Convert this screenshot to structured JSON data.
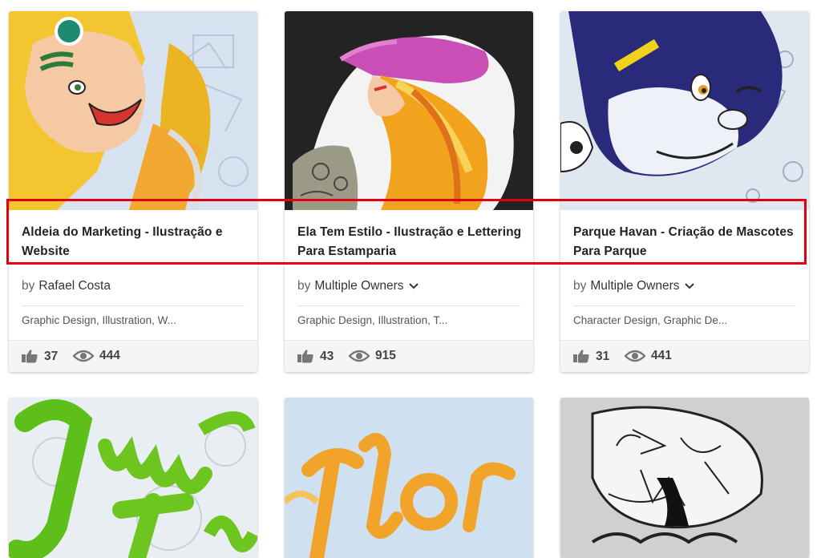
{
  "projects": [
    {
      "title": "Aldeia do Marketing - Ilustração e Website",
      "by": "by",
      "owner": "Rafael Costa",
      "fields": "Graphic Design, Illustration, W...",
      "likes": "37",
      "views": "444"
    },
    {
      "title": "Ela Tem Estilo - Ilustração e Lettering Para Estamparia",
      "by": "by",
      "owner": "Multiple Owners",
      "fields": "Graphic Design, Illustration, T...",
      "likes": "43",
      "views": "915"
    },
    {
      "title": "Parque Havan - Criação de Mascotes Para Parque",
      "by": "by",
      "owner": "Multiple Owners",
      "fields": "Character Design, Graphic De...",
      "likes": "31",
      "views": "441"
    }
  ],
  "colors": {
    "highlight": "#e0000f",
    "title_text": "#222222",
    "stats_bg": "#f5f5f5"
  },
  "icons": {
    "like": "thumbs-up-icon",
    "view": "eye-icon",
    "dropdown": "chevron-down-icon"
  }
}
